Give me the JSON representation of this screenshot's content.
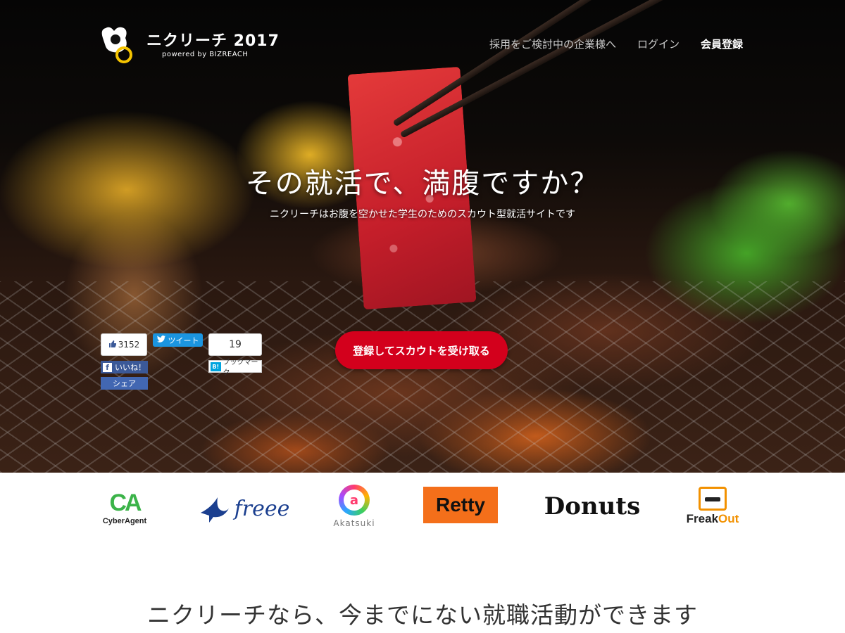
{
  "header": {
    "logo_title": "ニクリーチ 2017",
    "logo_sub": "powered by BIZREACH",
    "nav": [
      {
        "label": "採用をご検討中の企業様へ"
      },
      {
        "label": "ログイン"
      },
      {
        "label": "会員登録"
      }
    ]
  },
  "hero": {
    "headline": "その就活で、満腹ですか？",
    "tagline": "ニクリーチはお腹を空かせた学生のためのスカウト型就活サイトです",
    "cta_label": "登録してスカウトを受け取る"
  },
  "social": {
    "fb_count": "3152",
    "fb_like_label": "いいね！",
    "fb_share_label": "シェア",
    "tweet_label": "ツイート",
    "hatena_count": "19",
    "hatena_label": "ブックマーク",
    "hatena_icon_text": "B!",
    "fb_icon_text": "f"
  },
  "companies": [
    {
      "mark": "CA",
      "name": "CyberAgent"
    },
    {
      "name": "freee"
    },
    {
      "mark": "a",
      "name": "Akatsuki"
    },
    {
      "name": "Retty"
    },
    {
      "name": "Donuts"
    },
    {
      "name_a": "Freak",
      "name_b": "Out"
    }
  ],
  "section": {
    "title": "ニクリーチなら、今までにない就職活動ができます"
  },
  "colors": {
    "cta": "#d3001c",
    "facebook": "#3b5998",
    "twitter": "#1b95e0",
    "hatena": "#00a4de",
    "logo_ring": "#f5c400"
  },
  "icons": [
    "thumbs-up-icon",
    "twitter-bird-icon",
    "facebook-f-icon",
    "hatena-b-icon",
    "swallow-icon"
  ]
}
